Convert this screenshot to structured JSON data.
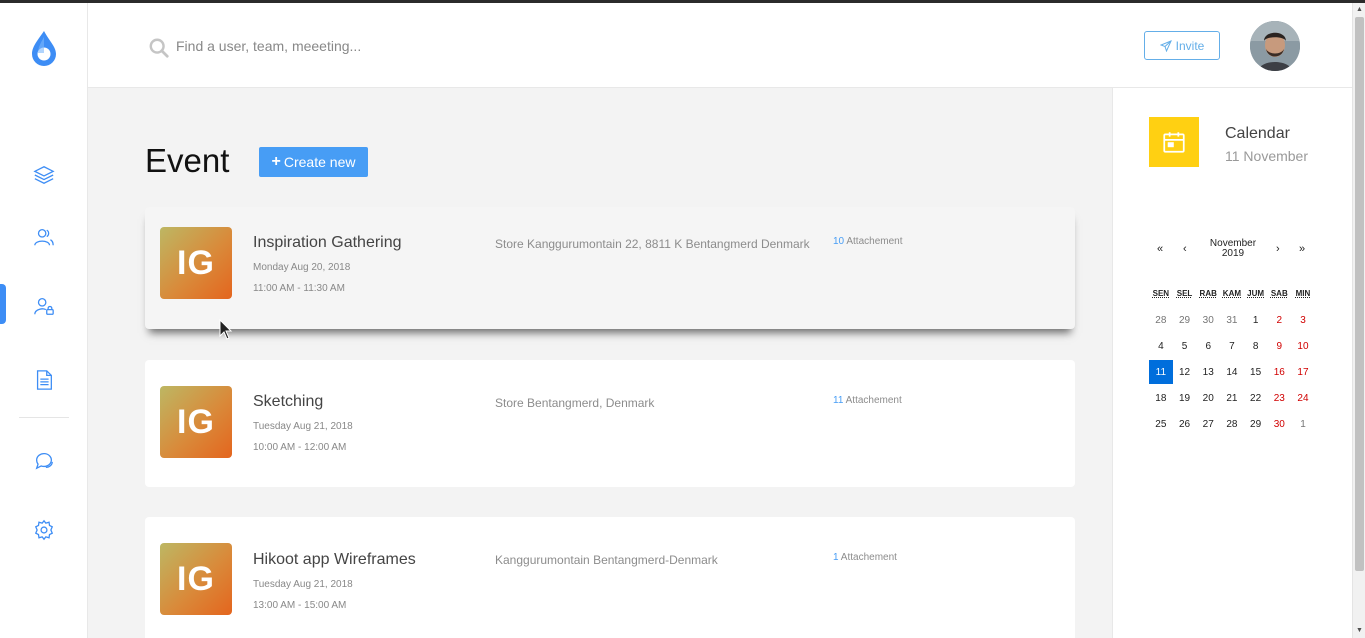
{
  "header": {
    "search_placeholder": "Find a user, team, meeeting...",
    "invite_label": "Invite"
  },
  "sidebar": {
    "items": [
      {
        "icon": "layers-icon"
      },
      {
        "icon": "users-icon"
      },
      {
        "icon": "user-lock-icon",
        "active": true
      },
      {
        "icon": "document-icon"
      },
      {
        "icon": "chat-icon"
      },
      {
        "icon": "gear-icon"
      }
    ],
    "active_color": "#3d8df5"
  },
  "main": {
    "title": "Event",
    "create_label": "Create new",
    "events": [
      {
        "initials": "IG",
        "title": "Inspiration Gathering",
        "date": "Monday Aug 20, 2018",
        "time": "11:00 AM - 11:30 AM",
        "location": "Store Kanggurumontain 22, 8811 K Bentangmerd Denmark",
        "attach_count": "10",
        "attach_label": "Attachement"
      },
      {
        "initials": "IG",
        "title": "Sketching",
        "date": "Tuesday Aug 21, 2018",
        "time": "10:00 AM - 12:00 AM",
        "location": "Store Bentangmerd, Denmark",
        "attach_count": "11",
        "attach_label": "Attachement"
      },
      {
        "initials": "IG",
        "title": "Hikoot app Wireframes",
        "date": "Tuesday Aug 21, 2018",
        "time": "13:00 AM - 15:00 AM",
        "location": "Kanggurumontain Bentangmerd-Denmark",
        "attach_count": "1",
        "attach_label": "Attachement"
      }
    ]
  },
  "calendar": {
    "title": "Calendar",
    "subtitle": "11 November",
    "nav": {
      "prev_year": "«",
      "prev": "‹",
      "next": "›",
      "next_year": "»"
    },
    "month_label_1": "November",
    "month_label_2": "2019",
    "weekdays": [
      "SEN",
      "SEL",
      "RAB",
      "KAM",
      "JUM",
      "SAB",
      "MIN"
    ],
    "weeks": [
      [
        "28",
        "29",
        "30",
        "31",
        "1",
        "2",
        "3"
      ],
      [
        "4",
        "5",
        "6",
        "7",
        "8",
        "9",
        "10"
      ],
      [
        "11",
        "12",
        "13",
        "14",
        "15",
        "16",
        "17"
      ],
      [
        "18",
        "19",
        "20",
        "21",
        "22",
        "23",
        "24"
      ],
      [
        "25",
        "26",
        "27",
        "28",
        "29",
        "30",
        "1"
      ]
    ],
    "selected_day": "11",
    "accent_color": "#ffd012",
    "selected_color": "#006edc",
    "weekend_color": "#d10000"
  }
}
